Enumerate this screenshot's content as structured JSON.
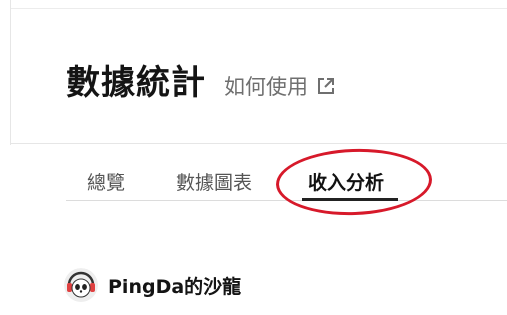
{
  "header": {
    "title": "數據統計",
    "help_label": "如何使用",
    "help_icon": "external-link-icon"
  },
  "tabs": [
    {
      "label": "總覽",
      "active": false
    },
    {
      "label": "數據圖表",
      "active": false
    },
    {
      "label": "收入分析",
      "active": true
    }
  ],
  "annotation": {
    "color": "#d7192a"
  },
  "profile": {
    "avatar_icon": "panda-headphones-avatar",
    "name": "PingDa的沙龍"
  }
}
